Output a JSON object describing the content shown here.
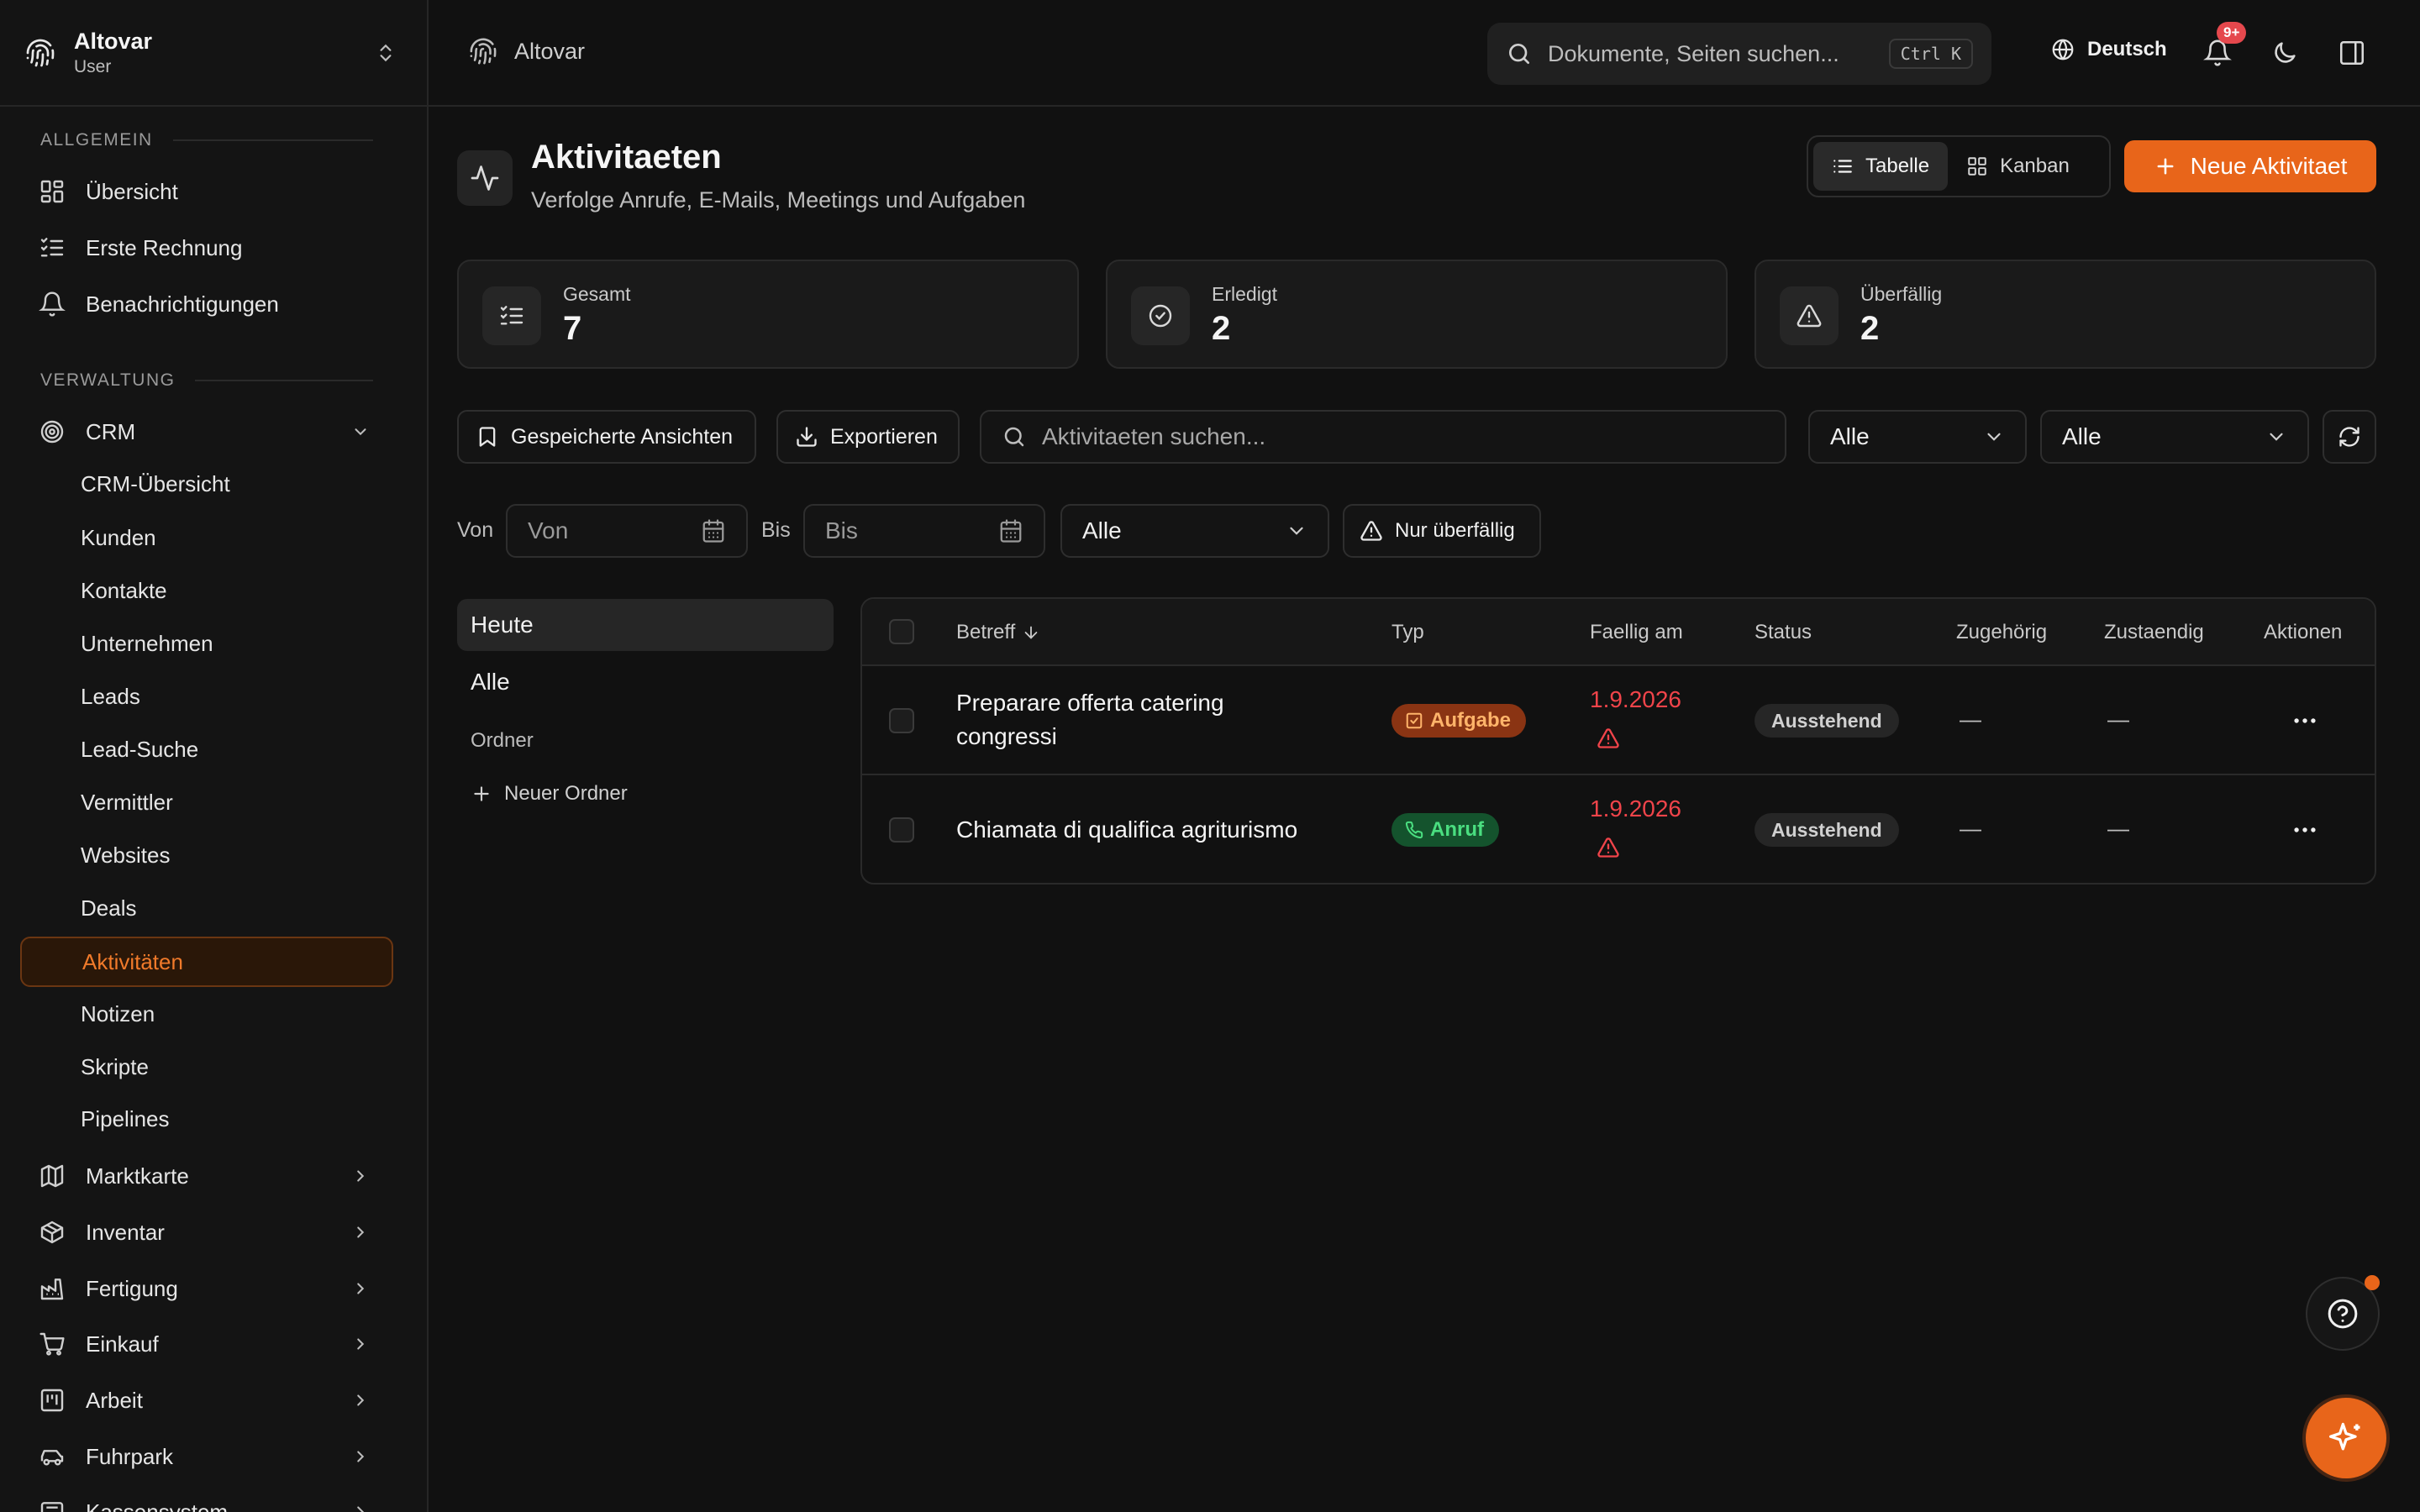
{
  "app": {
    "name": "Altovar",
    "role": "User"
  },
  "topbar": {
    "brand": "Altovar",
    "search_placeholder": "Dokumente, Seiten suchen...",
    "search_shortcut": "Ctrl K",
    "language": "Deutsch",
    "notification_badge": "9+"
  },
  "sidebar": {
    "section_general": "ALLGEMEIN",
    "general_items": [
      {
        "label": "Übersicht",
        "icon": "dashboard-icon"
      },
      {
        "label": "Erste Rechnung",
        "icon": "checklist-icon"
      },
      {
        "label": "Benachrichtigungen",
        "icon": "bell-icon"
      }
    ],
    "section_admin": "VERWALTUNG",
    "crm": {
      "label": "CRM",
      "icon": "target-icon",
      "expanded": true
    },
    "crm_items": [
      {
        "label": "CRM-Übersicht"
      },
      {
        "label": "Kunden"
      },
      {
        "label": "Kontakte"
      },
      {
        "label": "Unternehmen"
      },
      {
        "label": "Leads"
      },
      {
        "label": "Lead-Suche"
      },
      {
        "label": "Vermittler"
      },
      {
        "label": "Websites"
      },
      {
        "label": "Deals"
      },
      {
        "label": "Aktivitäten",
        "active": true
      },
      {
        "label": "Notizen"
      },
      {
        "label": "Skripte"
      },
      {
        "label": "Pipelines"
      }
    ],
    "admin_items": [
      {
        "label": "Marktkarte",
        "icon": "map-icon"
      },
      {
        "label": "Inventar",
        "icon": "box-icon"
      },
      {
        "label": "Fertigung",
        "icon": "factory-icon"
      },
      {
        "label": "Einkauf",
        "icon": "cart-icon"
      },
      {
        "label": "Arbeit",
        "icon": "kanban-icon"
      },
      {
        "label": "Fuhrpark",
        "icon": "car-icon"
      },
      {
        "label": "Kassensystem",
        "icon": "register-icon"
      }
    ]
  },
  "page": {
    "title": "Aktivitaeten",
    "subtitle": "Verfolge Anrufe, E-Mails, Meetings und Aufgaben",
    "view_table": "Tabelle",
    "view_kanban": "Kanban",
    "new_button": "Neue Aktivitaet"
  },
  "stats": [
    {
      "label": "Gesamt",
      "value": "7",
      "icon": "checklist-icon"
    },
    {
      "label": "Erledigt",
      "value": "2",
      "icon": "check-circle-icon"
    },
    {
      "label": "Überfällig",
      "value": "2",
      "icon": "alert-triangle-icon"
    }
  ],
  "toolbar": {
    "saved_views": "Gespeicherte Ansichten",
    "export": "Exportieren",
    "search_placeholder": "Aktivitaeten suchen...",
    "filter_type": "Alle",
    "filter_status": "Alle"
  },
  "filters": {
    "from_label": "Von",
    "from_placeholder": "Von",
    "to_label": "Bis",
    "to_placeholder": "Bis",
    "assignee": "Alle",
    "overdue_only": "Nur überfällig"
  },
  "folders": {
    "today": "Heute",
    "all": "Alle",
    "folder_label": "Ordner",
    "new_folder": "Neuer Ordner"
  },
  "table": {
    "columns": [
      "Betreff",
      "Typ",
      "Faellig am",
      "Status",
      "Zugehörig",
      "Zustaendig",
      "Aktionen"
    ],
    "rows": [
      {
        "subject": "Preparare offerta catering congressi",
        "type": "Aufgabe",
        "due": "1.9.2026",
        "status": "Ausstehend",
        "related": "—",
        "assignee": "—"
      },
      {
        "subject": "Chiamata di qualifica agriturismo",
        "type": "Anruf",
        "due": "1.9.2026",
        "status": "Ausstehend",
        "related": "—",
        "assignee": "—"
      }
    ]
  },
  "colors": {
    "accent": "#e8651a",
    "overdue": "#f0444a",
    "call": "#4ade80",
    "background": "#111111"
  }
}
